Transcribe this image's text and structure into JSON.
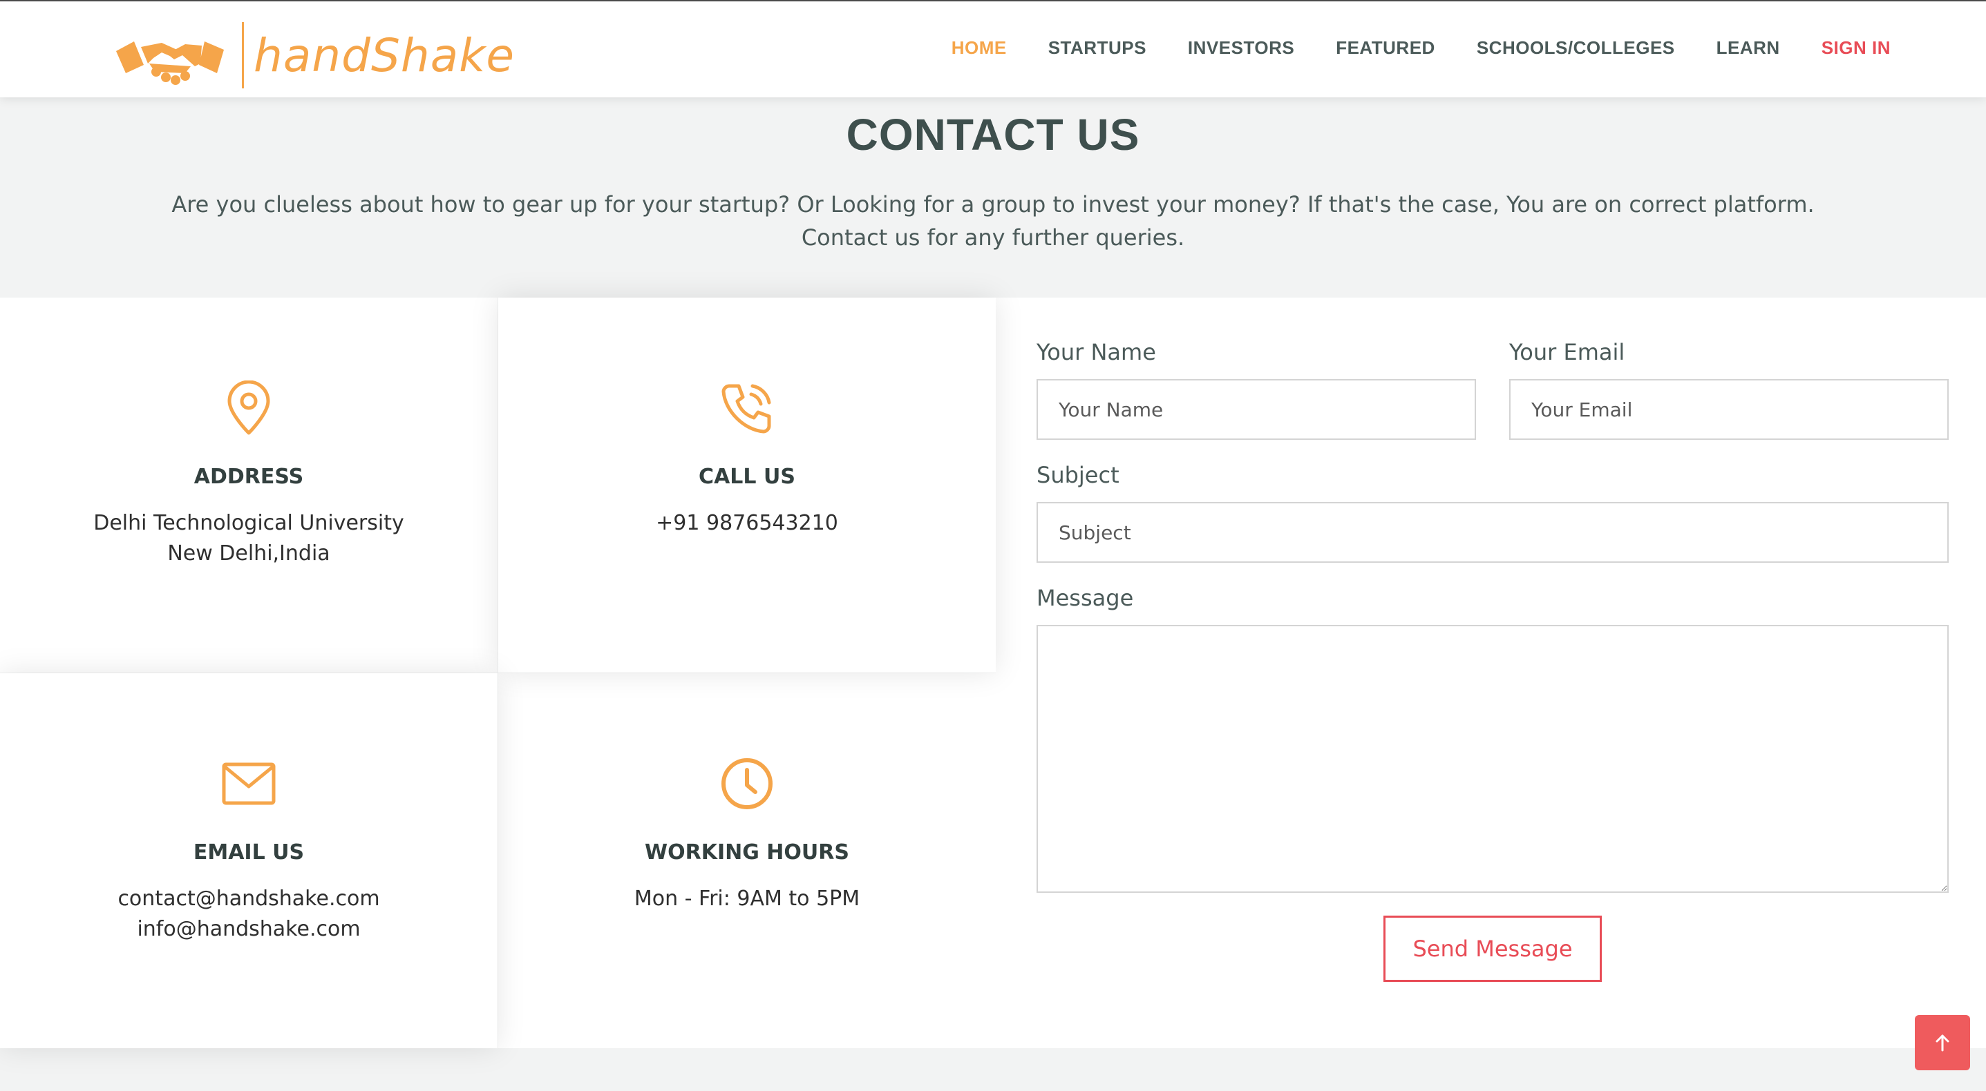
{
  "brand": {
    "name": "handShake",
    "color": "#f5a54a",
    "logo_icon": "handshake-icon"
  },
  "nav": {
    "items": [
      {
        "label": "HOME",
        "state": "active"
      },
      {
        "label": "STARTUPS"
      },
      {
        "label": "INVESTORS"
      },
      {
        "label": "FEATURED"
      },
      {
        "label": "SCHOOLS/COLLEGES"
      },
      {
        "label": "LEARN"
      },
      {
        "label": "SIGN IN",
        "color": "#e84c56"
      }
    ]
  },
  "hero": {
    "title": "CONTACT US",
    "text": "Are you clueless about how to gear up for your startup? Or Looking for a group to invest your money? If that's the case, You are on correct platform. Contact us for any further queries."
  },
  "info": {
    "address": {
      "icon": "map-pin-icon",
      "title": "ADDRESS",
      "lines": [
        "Delhi Technological University",
        "New Delhi,India"
      ]
    },
    "call": {
      "icon": "phone-icon",
      "title": "CALL US",
      "lines": [
        "+91 9876543210"
      ]
    },
    "email": {
      "icon": "envelope-icon",
      "title": "EMAIL US",
      "lines": [
        "contact@handshake.com",
        "info@handshake.com"
      ]
    },
    "hours": {
      "icon": "clock-icon",
      "title": "WORKING HOURS",
      "lines": [
        "Mon - Fri: 9AM to 5PM"
      ]
    }
  },
  "form": {
    "name_label": "Your Name",
    "name_placeholder": "Your Name",
    "email_label": "Your Email",
    "email_placeholder": "Your Email",
    "subject_label": "Subject",
    "subject_placeholder": "Subject",
    "message_label": "Message",
    "message_placeholder": "",
    "submit_label": "Send Message"
  },
  "back_to_top": {
    "icon": "arrow-up-icon",
    "color": "#ef5b5d"
  },
  "colors": {
    "accent": "#f5a54a",
    "danger": "#e84c56",
    "heading": "#3e4f4d",
    "text": "#4b5a59"
  }
}
